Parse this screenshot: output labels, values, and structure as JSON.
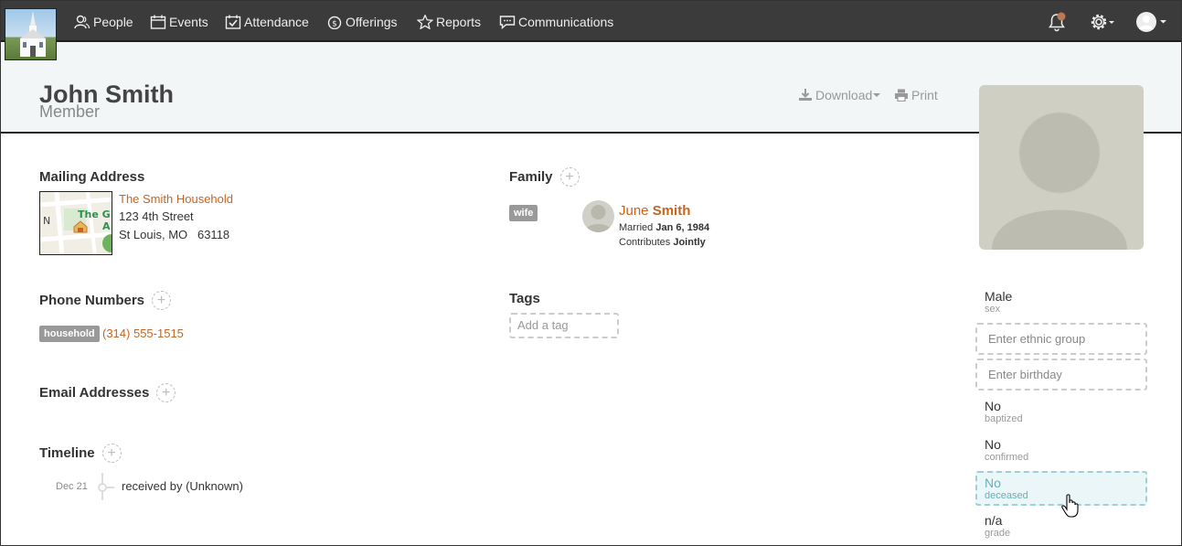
{
  "nav": {
    "items": [
      {
        "label": "People",
        "icon": "people-icon"
      },
      {
        "label": "Events",
        "icon": "calendar-icon"
      },
      {
        "label": "Attendance",
        "icon": "calendar-check-icon"
      },
      {
        "label": "Offerings",
        "icon": "money-icon"
      },
      {
        "label": "Reports",
        "icon": "star-icon"
      },
      {
        "label": "Communications",
        "icon": "chat-icon"
      }
    ]
  },
  "header": {
    "name": "John Smith",
    "role": "Member",
    "download_label": "Download",
    "print_label": "Print"
  },
  "mailing": {
    "title": "Mailing Address",
    "household": "The Smith Household",
    "street": "123 4th Street",
    "city_line": "St Louis, MO   63118",
    "map_label_1": "The G",
    "map_label_2": "A",
    "map_label_n": "N"
  },
  "phones": {
    "title": "Phone Numbers",
    "items": [
      {
        "type": "household",
        "number": "(314) 555-1515"
      }
    ]
  },
  "emails": {
    "title": "Email Addresses"
  },
  "timeline": {
    "title": "Timeline",
    "items": [
      {
        "date": "Dec 21",
        "text": "received by (Unknown)"
      }
    ]
  },
  "family": {
    "title": "Family",
    "members": [
      {
        "relation": "wife",
        "first": "June",
        "last": "Smith",
        "married_prefix": "Married",
        "married_date": "Jan 6, 1984",
        "contributes_prefix": "Contributes",
        "contributes_value": "Jointly"
      }
    ]
  },
  "tags": {
    "title": "Tags",
    "placeholder": "Add a tag"
  },
  "details": {
    "sex_value": "Male",
    "sex_label": "sex",
    "ethnic_placeholder": "Enter ethnic group",
    "birthday_placeholder": "Enter birthday",
    "baptized_value": "No",
    "baptized_label": "baptized",
    "confirmed_value": "No",
    "confirmed_label": "confirmed",
    "deceased_value": "No",
    "deceased_label": "deceased",
    "grade_value": "n/a",
    "grade_label": "grade"
  },
  "colors": {
    "accent": "#c8641e",
    "nav_bg": "#3b3b3b",
    "highlight": "#68b0b8"
  }
}
